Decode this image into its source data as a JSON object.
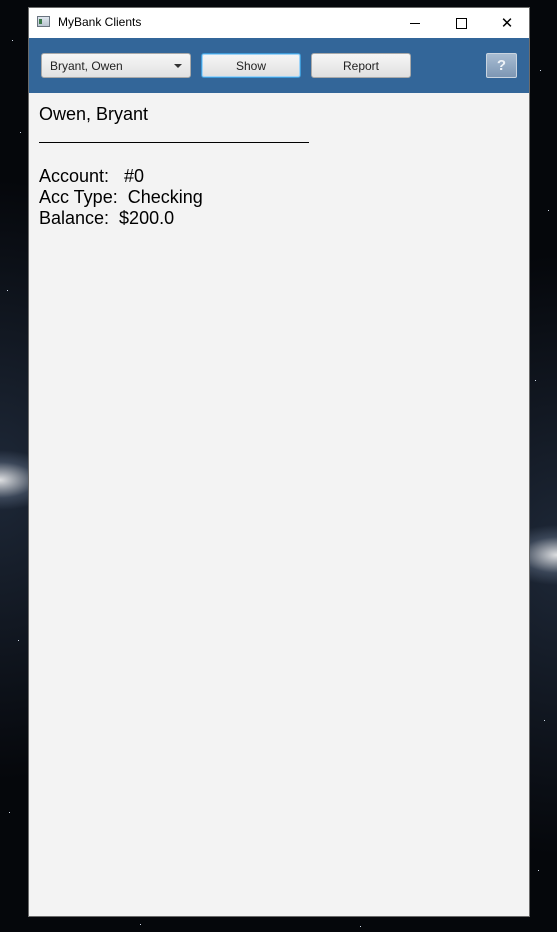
{
  "window": {
    "title": "MyBank Clients"
  },
  "toolbar": {
    "client_select": {
      "selected": "Bryant, Owen"
    },
    "show_label": "Show",
    "report_label": "Report",
    "help_label": "?"
  },
  "client": {
    "name": "Owen, Bryant",
    "account_line": "Account:   #0",
    "type_line": "Acc Type:  Checking",
    "balance_line": "Balance:  $200.0"
  },
  "colors": {
    "toolbar_bg": "#336699",
    "content_bg": "#f3f3f3",
    "focus_border": "#3f9bd8"
  }
}
